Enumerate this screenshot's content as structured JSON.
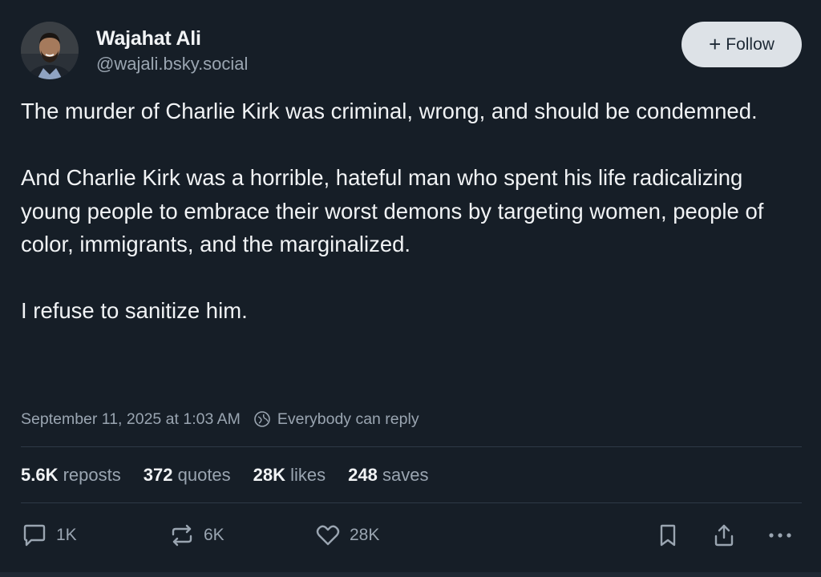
{
  "author": {
    "display_name": "Wajahat Ali",
    "handle": "@wajali.bsky.social"
  },
  "follow_button": {
    "icon": "plus-icon",
    "label": "Follow"
  },
  "post": {
    "paragraphs": [
      "The murder of Charlie Kirk was criminal, wrong, and should be condemned.",
      "And Charlie Kirk was a horrible, hateful man who spent his life radicalizing young people to embrace their worst demons by targeting women, people of color, immigrants, and the marginalized.",
      "I refuse to sanitize him."
    ],
    "timestamp": "September 11, 2025 at 1:03 AM",
    "reply_setting": "Everybody can reply"
  },
  "stats": {
    "reposts": {
      "count": "5.6K",
      "label": "reposts"
    },
    "quotes": {
      "count": "372",
      "label": "quotes"
    },
    "likes": {
      "count": "28K",
      "label": "likes"
    },
    "saves": {
      "count": "248",
      "label": "saves"
    }
  },
  "actions": {
    "reply": {
      "icon": "reply-bubble-icon",
      "count": "1K"
    },
    "repost": {
      "icon": "repost-icon",
      "count": "6K"
    },
    "like": {
      "icon": "heart-icon",
      "count": "28K"
    },
    "bookmark": {
      "icon": "bookmark-icon"
    },
    "share": {
      "icon": "share-icon"
    },
    "more": {
      "icon": "more-horizontal-icon"
    }
  },
  "colors": {
    "background": "#161e27",
    "text_primary": "#f1f3f5",
    "text_secondary": "#9aa5b1",
    "follow_button_bg": "#dde2e7",
    "divider": "#2e3946"
  }
}
